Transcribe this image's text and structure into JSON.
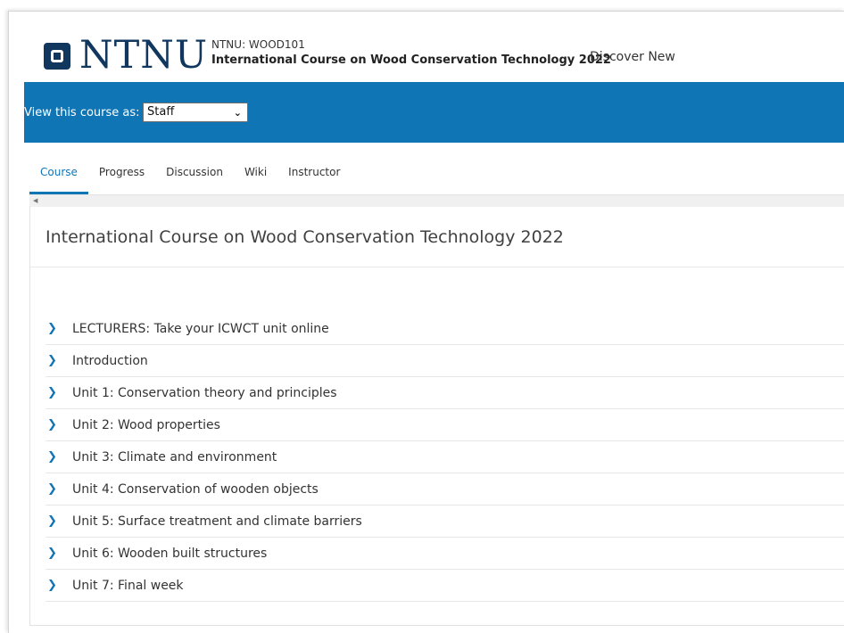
{
  "header": {
    "logo_text": "NTNU",
    "course_org": "NTNU: WOOD101",
    "course_title": "International Course on Wood Conservation Technology 2022",
    "discover_link": "Discover New"
  },
  "view_as": {
    "label": "View this course as:",
    "selected": "Staff"
  },
  "tabs": [
    {
      "label": "Course",
      "active": true
    },
    {
      "label": "Progress",
      "active": false
    },
    {
      "label": "Discussion",
      "active": false
    },
    {
      "label": "Wiki",
      "active": false
    },
    {
      "label": "Instructor",
      "active": false
    }
  ],
  "main": {
    "title": "International Course on Wood Conservation Technology 2022",
    "sections": [
      "LECTURERS: Take your ICWCT unit online",
      "Introduction",
      "Unit 1: Conservation theory and principles",
      "Unit 2: Wood properties",
      "Unit 3: Climate and environment",
      "Unit 4: Conservation of wooden objects",
      "Unit 5: Surface treatment and climate barriers",
      "Unit 6: Wooden built structures",
      "Unit 7: Final week"
    ]
  },
  "icons": {
    "section_expand": "chevron-right-icon",
    "select_dropdown": "chevron-down-icon",
    "scroll_left": "scroll-left-arrow-icon"
  },
  "colors": {
    "brand_blue": "#0f75b5",
    "logo_navy": "#12375e"
  }
}
